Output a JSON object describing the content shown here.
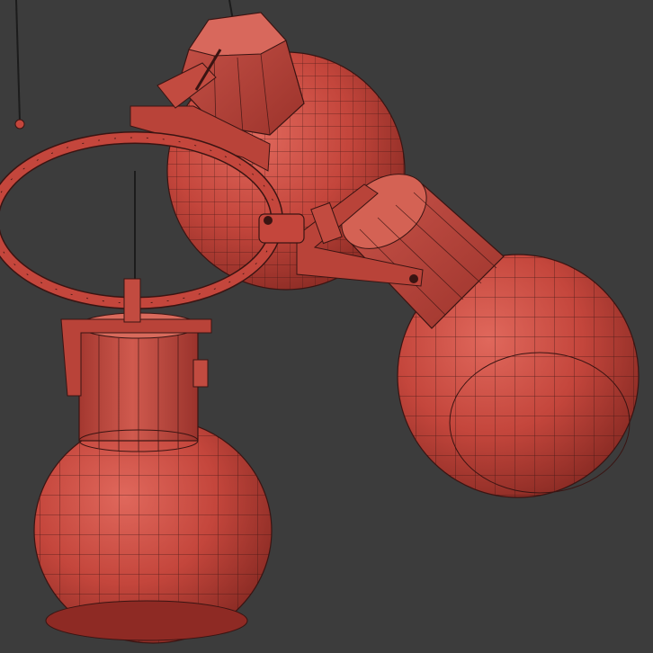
{
  "scene": {
    "subject": "chandelier-wireframe",
    "background_color": "#3c3c3c",
    "material_color": "#c4463c",
    "material_shadow": "#8e2a24",
    "material_highlight": "#e0685c",
    "wire_color": "#3a1412",
    "shades": 3,
    "rendering_style": "wireframe-shaded"
  }
}
